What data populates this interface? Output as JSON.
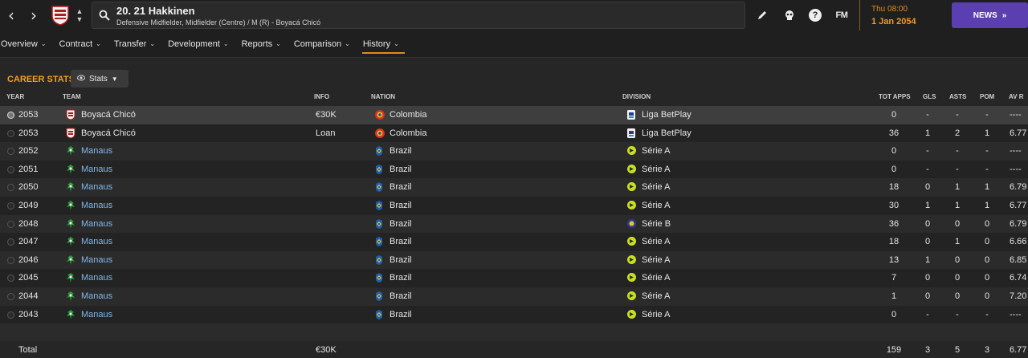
{
  "header": {
    "player_name": "20. 21 Hakkinen",
    "player_sub": "Defensive Midfielder, Midfielder (Centre) / M (R) - Boyacá Chicó",
    "fm_label": "FM",
    "date_day": "Thu 08:00",
    "date_date": "1 Jan 2054",
    "news_label": "NEWS",
    "accent_color": "#e08a1e",
    "news_color": "#5b3fb0"
  },
  "tabs": [
    {
      "label": "Overview"
    },
    {
      "label": "Contract"
    },
    {
      "label": "Transfer"
    },
    {
      "label": "Development"
    },
    {
      "label": "Reports"
    },
    {
      "label": "Comparison"
    },
    {
      "label": "History"
    }
  ],
  "section": {
    "title": "CAREER STATS",
    "stats_button": "Stats"
  },
  "columns": {
    "year": "YEAR",
    "team": "TEAM",
    "info": "INFO",
    "nation": "NATION",
    "division": "DIVISION",
    "apps": "TOT APPS",
    "gls": "GLS",
    "asts": "ASTS",
    "pom": "POM",
    "avr": "AV R"
  },
  "rows": [
    {
      "year": "2053",
      "team": "Boyacá Chicó",
      "team_type": "boyaca",
      "info": "€30K",
      "nation": "Colombia",
      "nation_type": "colombia",
      "division": "Liga BetPlay",
      "div_type": "betplay",
      "apps": "0",
      "gls": "-",
      "asts": "-",
      "pom": "-",
      "avr": "----"
    },
    {
      "year": "2053",
      "team": "Boyacá Chicó",
      "team_type": "boyaca",
      "info": "Loan",
      "nation": "Colombia",
      "nation_type": "colombia",
      "division": "Liga BetPlay",
      "div_type": "betplay",
      "apps": "36",
      "gls": "1",
      "asts": "2",
      "pom": "1",
      "avr": "6.77"
    },
    {
      "year": "2052",
      "team": "Manaus",
      "team_type": "manaus",
      "info": "",
      "nation": "Brazil",
      "nation_type": "brazil",
      "division": "Série A",
      "div_type": "seriea",
      "apps": "0",
      "gls": "-",
      "asts": "-",
      "pom": "-",
      "avr": "----"
    },
    {
      "year": "2051",
      "team": "Manaus",
      "team_type": "manaus",
      "info": "",
      "nation": "Brazil",
      "nation_type": "brazil",
      "division": "Série A",
      "div_type": "seriea",
      "apps": "0",
      "gls": "-",
      "asts": "-",
      "pom": "-",
      "avr": "----"
    },
    {
      "year": "2050",
      "team": "Manaus",
      "team_type": "manaus",
      "info": "",
      "nation": "Brazil",
      "nation_type": "brazil",
      "division": "Série A",
      "div_type": "seriea",
      "apps": "18",
      "gls": "0",
      "asts": "1",
      "pom": "1",
      "avr": "6.79"
    },
    {
      "year": "2049",
      "team": "Manaus",
      "team_type": "manaus",
      "info": "",
      "nation": "Brazil",
      "nation_type": "brazil",
      "division": "Série A",
      "div_type": "seriea",
      "apps": "30",
      "gls": "1",
      "asts": "1",
      "pom": "1",
      "avr": "6.77"
    },
    {
      "year": "2048",
      "team": "Manaus",
      "team_type": "manaus",
      "info": "",
      "nation": "Brazil",
      "nation_type": "brazil",
      "division": "Série B",
      "div_type": "serieb",
      "apps": "36",
      "gls": "0",
      "asts": "0",
      "pom": "0",
      "avr": "6.79"
    },
    {
      "year": "2047",
      "team": "Manaus",
      "team_type": "manaus",
      "info": "",
      "nation": "Brazil",
      "nation_type": "brazil",
      "division": "Série A",
      "div_type": "seriea",
      "apps": "18",
      "gls": "0",
      "asts": "1",
      "pom": "0",
      "avr": "6.66"
    },
    {
      "year": "2046",
      "team": "Manaus",
      "team_type": "manaus",
      "info": "",
      "nation": "Brazil",
      "nation_type": "brazil",
      "division": "Série A",
      "div_type": "seriea",
      "apps": "13",
      "gls": "1",
      "asts": "0",
      "pom": "0",
      "avr": "6.85"
    },
    {
      "year": "2045",
      "team": "Manaus",
      "team_type": "manaus",
      "info": "",
      "nation": "Brazil",
      "nation_type": "brazil",
      "division": "Série A",
      "div_type": "seriea",
      "apps": "7",
      "gls": "0",
      "asts": "0",
      "pom": "0",
      "avr": "6.74"
    },
    {
      "year": "2044",
      "team": "Manaus",
      "team_type": "manaus",
      "info": "",
      "nation": "Brazil",
      "nation_type": "brazil",
      "division": "Série A",
      "div_type": "seriea",
      "apps": "1",
      "gls": "0",
      "asts": "0",
      "pom": "0",
      "avr": "7.20"
    },
    {
      "year": "2043",
      "team": "Manaus",
      "team_type": "manaus",
      "info": "",
      "nation": "Brazil",
      "nation_type": "brazil",
      "division": "Série A",
      "div_type": "seriea",
      "apps": "0",
      "gls": "-",
      "asts": "-",
      "pom": "-",
      "avr": "----"
    }
  ],
  "total": {
    "label": "Total",
    "info": "€30K",
    "apps": "159",
    "gls": "3",
    "asts": "5",
    "pom": "3",
    "avr": "6.77"
  }
}
